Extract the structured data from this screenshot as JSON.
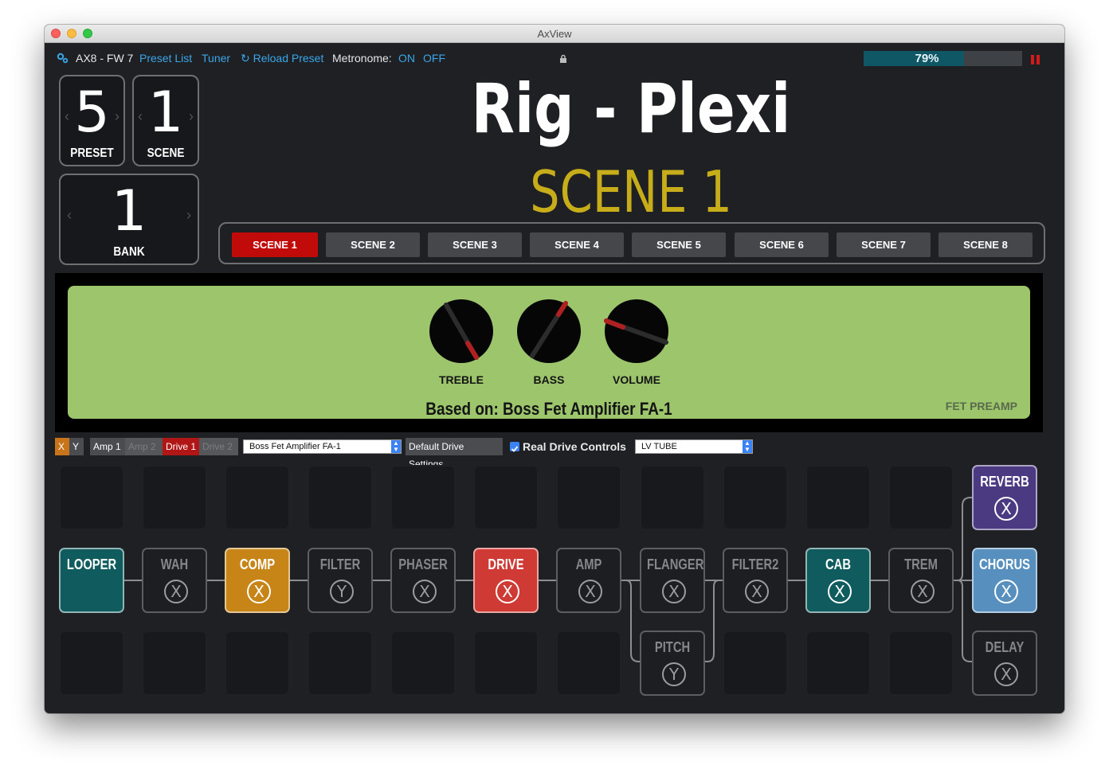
{
  "window": {
    "title": "AxView"
  },
  "toolbar": {
    "device": "AX8 - FW 7",
    "preset_list": "Preset List",
    "tuner": "Tuner",
    "reload": "Reload Preset",
    "metronome_label": "Metronome:",
    "metronome_on": "ON",
    "metronome_off": "OFF",
    "progress_text": "79%",
    "progress_value": 0.79
  },
  "preset": {
    "number": "5",
    "label": "PRESET"
  },
  "scene": {
    "number": "1",
    "label": "SCENE"
  },
  "bank": {
    "number": "1",
    "label": "BANK"
  },
  "rig_name": "Rig - Plexi",
  "scene_name": "SCENE 1",
  "scenes": [
    "SCENE 1",
    "SCENE 2",
    "SCENE 3",
    "SCENE 4",
    "SCENE 5",
    "SCENE 6",
    "SCENE 7",
    "SCENE 8"
  ],
  "active_scene": 0,
  "amp": {
    "knobs": [
      {
        "label": "TREBLE"
      },
      {
        "label": "BASS"
      },
      {
        "label": "VOLUME"
      }
    ],
    "based_on": "Based on: Boss Fet Amplifier FA-1",
    "type_label": "FET PREAMP",
    "face_color": "#9cc56c"
  },
  "controls": {
    "x": "X",
    "y": "Y",
    "amp1": "Amp 1",
    "amp2": "Amp 2",
    "drive1": "Drive 1",
    "drive2": "Drive 2",
    "model": "Boss Fet Amplifier FA-1",
    "default_btn": "Default Drive Settings",
    "real_drive": "Real Drive Controls",
    "real_drive_checked": true,
    "clip_type": "LV TUBE"
  },
  "blocks": {
    "looper": {
      "label": "LOOPER",
      "color": "#0f5b5e"
    },
    "wah": {
      "label": "WAH",
      "state": "X"
    },
    "comp": {
      "label": "COMP",
      "state": "X",
      "color": "#c78417"
    },
    "filter": {
      "label": "FILTER",
      "state": "Y"
    },
    "phaser": {
      "label": "PHASER",
      "state": "X"
    },
    "drive": {
      "label": "DRIVE",
      "state": "X",
      "color": "#cf3b34"
    },
    "amp": {
      "label": "AMP",
      "state": "X"
    },
    "flanger": {
      "label": "FLANGER",
      "state": "X"
    },
    "filter2": {
      "label": "FILTER2",
      "state": "X"
    },
    "cab": {
      "label": "CAB",
      "state": "X",
      "color": "#0f5b5e"
    },
    "trem": {
      "label": "TREM",
      "state": "X"
    },
    "reverb": {
      "label": "REVERB",
      "state": "X",
      "color": "#4b3a82"
    },
    "chorus": {
      "label": "CHORUS",
      "state": "X",
      "color": "#5790be"
    },
    "pitch": {
      "label": "PITCH",
      "state": "Y"
    },
    "delay": {
      "label": "DELAY",
      "state": "X"
    }
  }
}
